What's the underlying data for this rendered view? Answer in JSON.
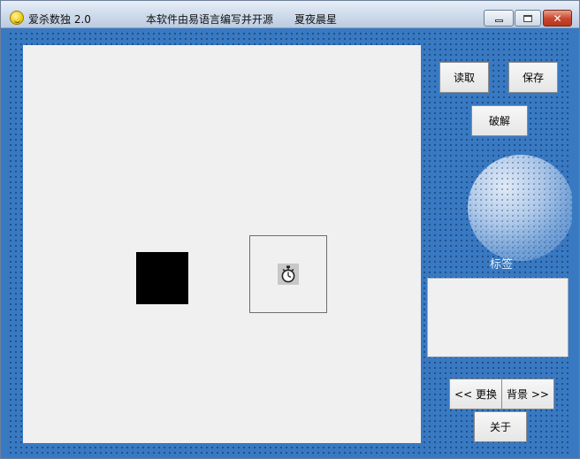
{
  "window": {
    "title": "爱杀数独 2.0",
    "subtitle": "本软件由易语言编写并开源",
    "author": "夏夜晨星",
    "close_glyph": "✕"
  },
  "toolbar": {
    "read_label": "读取",
    "save_label": "保存",
    "crack_label": "破解"
  },
  "panel": {
    "label_text": "标签",
    "prev_bg_label": "<< 更换",
    "next_bg_label": "背景 >>",
    "about_label": "关于"
  },
  "icons": {
    "app": "smiley-icon",
    "timer": "stopwatch-icon"
  },
  "colors": {
    "client_bg": "#3879c2",
    "board_bg": "#f0f0f0",
    "close_btn": "#c7452c"
  }
}
